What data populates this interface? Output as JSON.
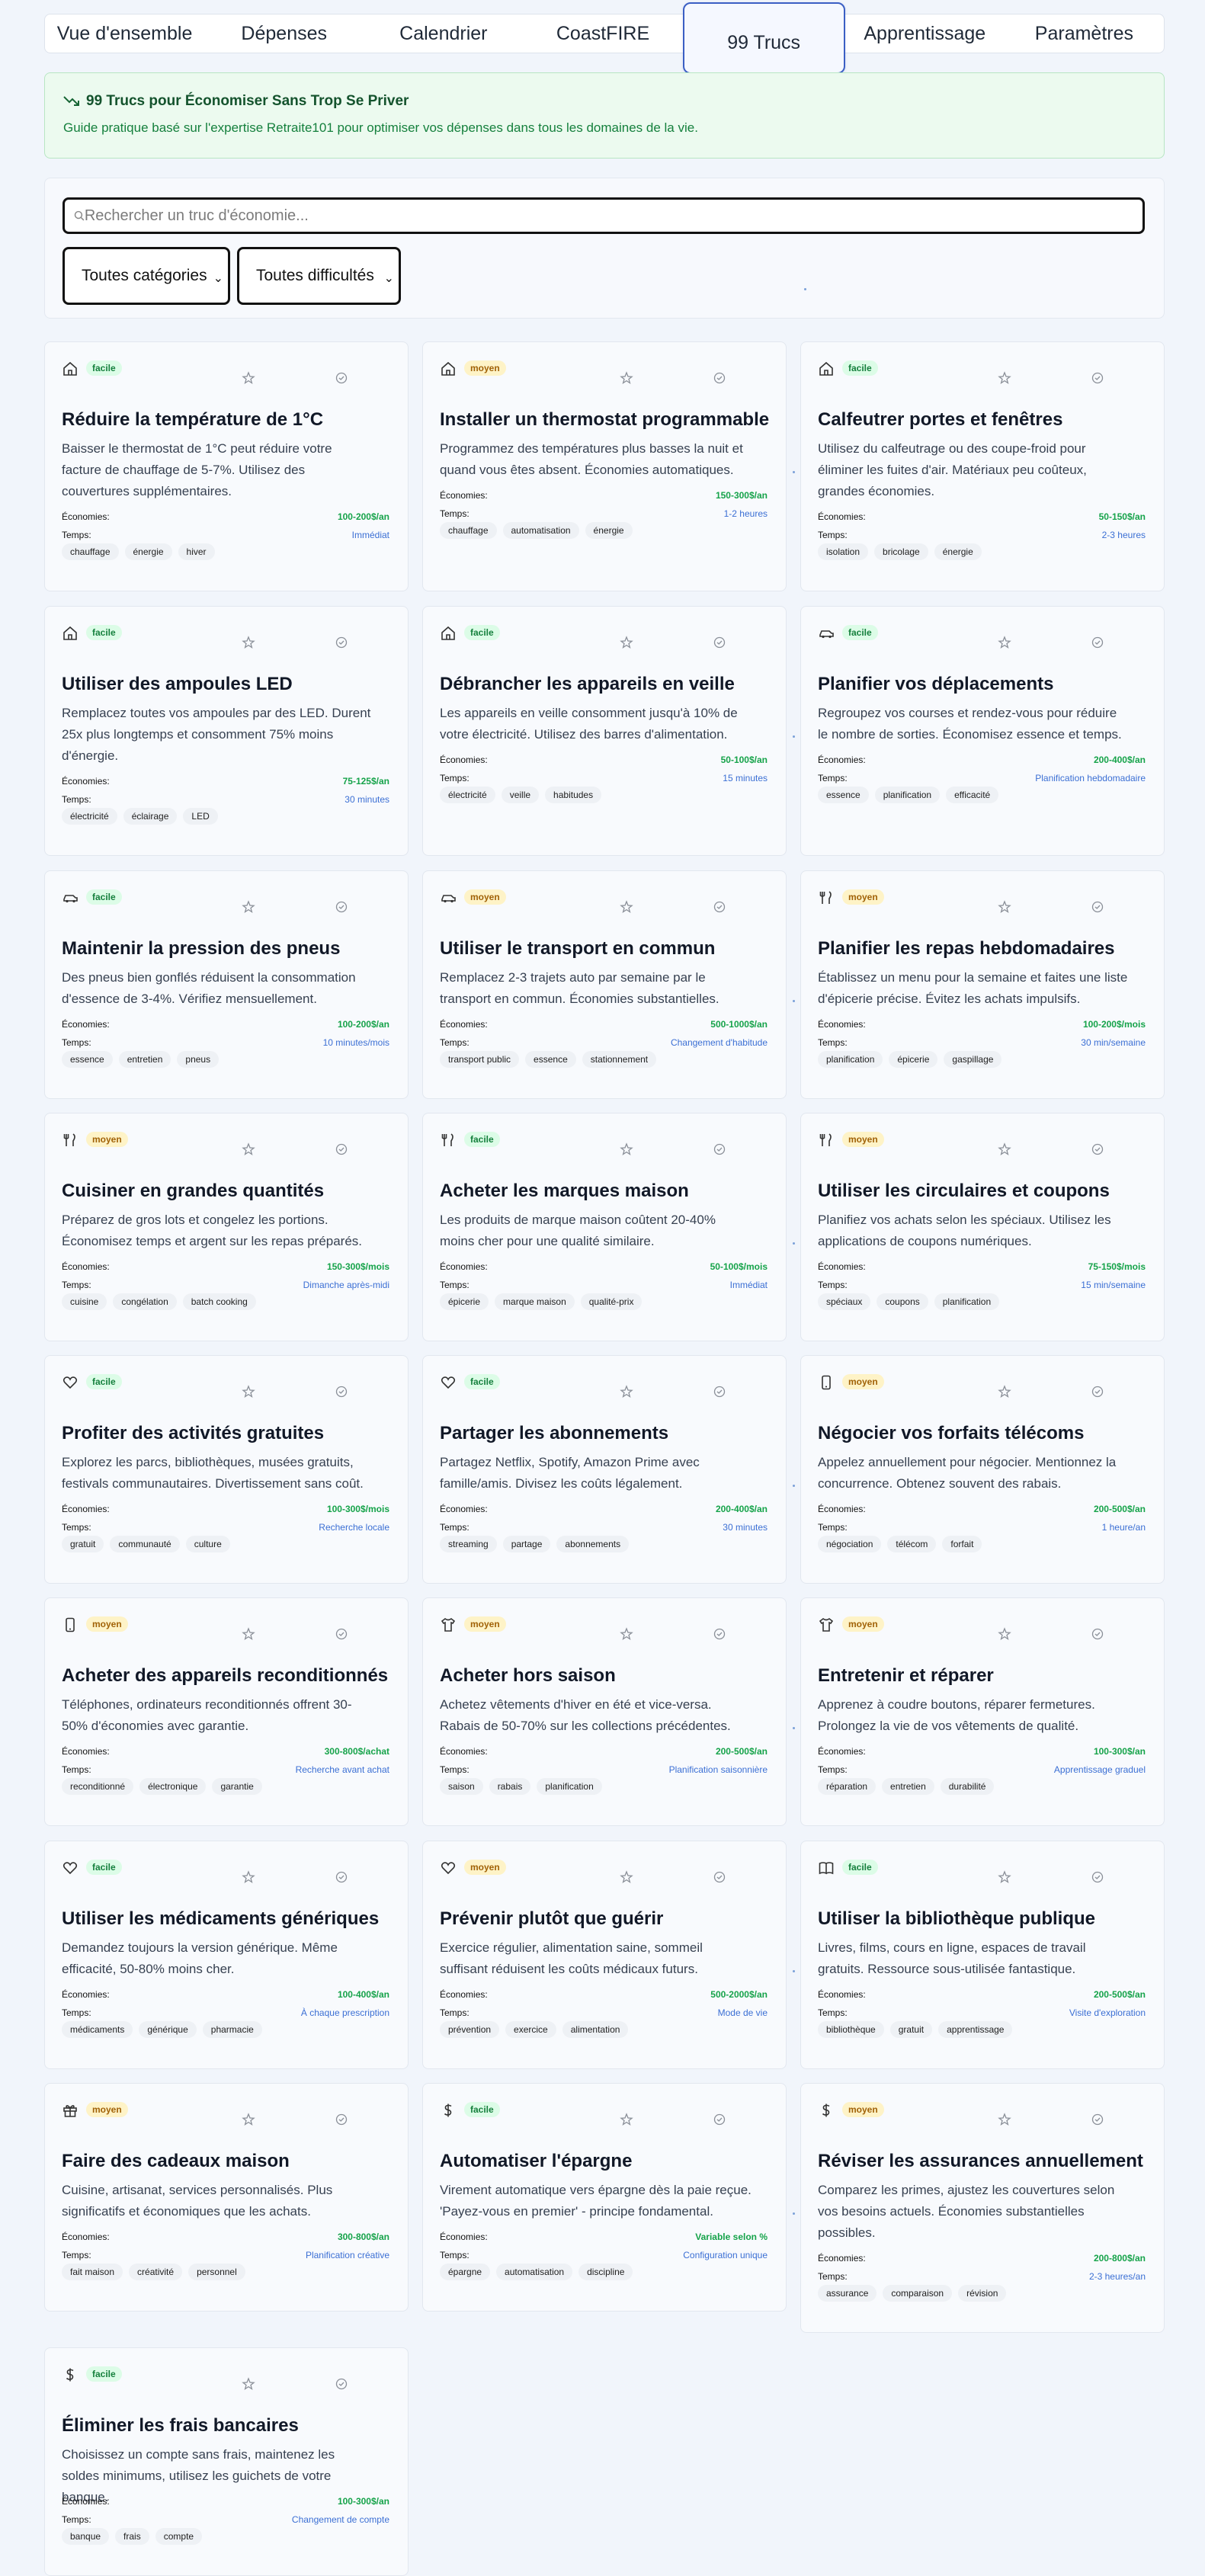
{
  "tabs": [
    {
      "label": "Vue d'ensemble"
    },
    {
      "label": "Dépenses"
    },
    {
      "label": "Calendrier"
    },
    {
      "label": "CoastFIRE"
    },
    {
      "label": "99 Trucs",
      "active": true
    },
    {
      "label": "Apprentissage"
    },
    {
      "label": "Paramètres"
    }
  ],
  "banner": {
    "title": "99 Trucs pour Économiser Sans Trop Se Priver",
    "subtitle": "Guide pratique basé sur l'expertise Retraite101 pour optimiser vos dépenses dans tous les domaines de la vie."
  },
  "filters": {
    "search_placeholder": "Rechercher un truc d'économie...",
    "category": "Toutes catégories",
    "difficulty": "Toutes difficultés"
  },
  "labels": {
    "savings": "Économies:",
    "time": "Temps:"
  },
  "colors": {
    "easy": "#dcfce7",
    "medium": "#fef3c7",
    "savings": "#16a34a",
    "time": "#3b6fd4"
  },
  "tips": [
    {
      "icon": "home-icon",
      "difficulty": "facile",
      "title": "Réduire la température de 1°C",
      "desc": "Baisser le thermostat de 1°C peut réduire votre facture de chauffage de 5-7%. Utilisez des couvertures supplémentaires.",
      "savings": "100-200$/an",
      "time": "Immédiat",
      "tags": [
        "chauffage",
        "énergie",
        "hiver"
      ]
    },
    {
      "icon": "home-icon",
      "difficulty": "moyen",
      "title": "Installer un thermostat programmable",
      "desc": "Programmez des températures plus basses la nuit et quand vous êtes absent. Économies automatiques.",
      "savings": "150-300$/an",
      "time": "1-2 heures",
      "tags": [
        "chauffage",
        "automatisation",
        "énergie"
      ]
    },
    {
      "icon": "home-icon",
      "difficulty": "facile",
      "title": "Calfeutrer portes et fenêtres",
      "desc": "Utilisez du calfeutrage ou des coupe-froid pour éliminer les fuites d'air. Matériaux peu coûteux, grandes économies.",
      "savings": "50-150$/an",
      "time": "2-3 heures",
      "tags": [
        "isolation",
        "bricolage",
        "énergie"
      ]
    },
    {
      "icon": "home-icon",
      "difficulty": "facile",
      "title": "Utiliser des ampoules LED",
      "desc": "Remplacez toutes vos ampoules par des LED. Durent 25x plus longtemps et consomment 75% moins d'énergie.",
      "savings": "75-125$/an",
      "time": "30 minutes",
      "tags": [
        "électricité",
        "éclairage",
        "LED"
      ]
    },
    {
      "icon": "home-icon",
      "difficulty": "facile",
      "title": "Débrancher les appareils en veille",
      "desc": "Les appareils en veille consomment jusqu'à 10% de votre électricité. Utilisez des barres d'alimentation.",
      "savings": "50-100$/an",
      "time": "15 minutes",
      "tags": [
        "électricité",
        "veille",
        "habitudes"
      ]
    },
    {
      "icon": "car-icon",
      "difficulty": "facile",
      "title": "Planifier vos déplacements",
      "desc": "Regroupez vos courses et rendez-vous pour réduire le nombre de sorties. Économisez essence et temps.",
      "savings": "200-400$/an",
      "time": "Planification hebdomadaire",
      "tags": [
        "essence",
        "planification",
        "efficacité"
      ]
    },
    {
      "icon": "car-icon",
      "difficulty": "facile",
      "title": "Maintenir la pression des pneus",
      "desc": "Des pneus bien gonflés réduisent la consommation d'essence de 3-4%. Vérifiez mensuellement.",
      "savings": "100-200$/an",
      "time": "10 minutes/mois",
      "tags": [
        "essence",
        "entretien",
        "pneus"
      ]
    },
    {
      "icon": "car-icon",
      "difficulty": "moyen",
      "title": "Utiliser le transport en commun",
      "desc": "Remplacez 2-3 trajets auto par semaine par le transport en commun. Économies substantielles.",
      "savings": "500-1000$/an",
      "time": "Changement d'habitude",
      "tags": [
        "transport public",
        "essence",
        "stationnement"
      ]
    },
    {
      "icon": "utensils-icon",
      "difficulty": "moyen",
      "title": "Planifier les repas hebdomadaires",
      "desc": "Établissez un menu pour la semaine et faites une liste d'épicerie précise. Évitez les achats impulsifs.",
      "savings": "100-200$/mois",
      "time": "30 min/semaine",
      "tags": [
        "planification",
        "épicerie",
        "gaspillage"
      ]
    },
    {
      "icon": "utensils-icon",
      "difficulty": "moyen",
      "title": "Cuisiner en grandes quantités",
      "desc": "Préparez de gros lots et congelez les portions. Économisez temps et argent sur les repas préparés.",
      "savings": "150-300$/mois",
      "time": "Dimanche après-midi",
      "tags": [
        "cuisine",
        "congélation",
        "batch cooking"
      ]
    },
    {
      "icon": "utensils-icon",
      "difficulty": "facile",
      "title": "Acheter les marques maison",
      "desc": "Les produits de marque maison coûtent 20-40% moins cher pour une qualité similaire.",
      "savings": "50-100$/mois",
      "time": "Immédiat",
      "tags": [
        "épicerie",
        "marque maison",
        "qualité-prix"
      ]
    },
    {
      "icon": "utensils-icon",
      "difficulty": "moyen",
      "title": "Utiliser les circulaires et coupons",
      "desc": "Planifiez vos achats selon les spéciaux. Utilisez les applications de coupons numériques.",
      "savings": "75-150$/mois",
      "time": "15 min/semaine",
      "tags": [
        "spéciaux",
        "coupons",
        "planification"
      ]
    },
    {
      "icon": "heart-icon",
      "difficulty": "facile",
      "title": "Profiter des activités gratuites",
      "desc": "Explorez les parcs, bibliothèques, musées gratuits, festivals communautaires. Divertissement sans coût.",
      "savings": "100-300$/mois",
      "time": "Recherche locale",
      "tags": [
        "gratuit",
        "communauté",
        "culture"
      ]
    },
    {
      "icon": "heart-icon",
      "difficulty": "facile",
      "title": "Partager les abonnements",
      "desc": "Partagez Netflix, Spotify, Amazon Prime avec famille/amis. Divisez les coûts légalement.",
      "savings": "200-400$/an",
      "time": "30 minutes",
      "tags": [
        "streaming",
        "partage",
        "abonnements"
      ]
    },
    {
      "icon": "phone-icon",
      "difficulty": "moyen",
      "title": "Négocier vos forfaits télécoms",
      "desc": "Appelez annuellement pour négocier. Mentionnez la concurrence. Obtenez souvent des rabais.",
      "savings": "200-500$/an",
      "time": "1 heure/an",
      "tags": [
        "négociation",
        "télécom",
        "forfait"
      ]
    },
    {
      "icon": "phone-icon",
      "difficulty": "moyen",
      "title": "Acheter des appareils reconditionnés",
      "desc": "Téléphones, ordinateurs reconditionnés offrent 30-50% d'économies avec garantie.",
      "savings": "300-800$/achat",
      "time": "Recherche avant achat",
      "tags": [
        "reconditionné",
        "électronique",
        "garantie"
      ]
    },
    {
      "icon": "shirt-icon",
      "difficulty": "moyen",
      "title": "Acheter hors saison",
      "desc": "Achetez vêtements d'hiver en été et vice-versa. Rabais de 50-70% sur les collections précédentes.",
      "savings": "200-500$/an",
      "time": "Planification saisonnière",
      "tags": [
        "saison",
        "rabais",
        "planification"
      ]
    },
    {
      "icon": "shirt-icon",
      "difficulty": "moyen",
      "title": "Entretenir et réparer",
      "desc": "Apprenez à coudre boutons, réparer fermetures. Prolongez la vie de vos vêtements de qualité.",
      "savings": "100-300$/an",
      "time": "Apprentissage graduel",
      "tags": [
        "réparation",
        "entretien",
        "durabilité"
      ]
    },
    {
      "icon": "heart-icon",
      "difficulty": "facile",
      "title": "Utiliser les médicaments génériques",
      "desc": "Demandez toujours la version générique. Même efficacité, 50-80% moins cher.",
      "savings": "100-400$/an",
      "time": "À chaque prescription",
      "tags": [
        "médicaments",
        "générique",
        "pharmacie"
      ]
    },
    {
      "icon": "heart-icon",
      "difficulty": "moyen",
      "title": "Prévenir plutôt que guérir",
      "desc": "Exercice régulier, alimentation saine, sommeil suffisant réduisent les coûts médicaux futurs.",
      "savings": "500-2000$/an",
      "time": "Mode de vie",
      "tags": [
        "prévention",
        "exercice",
        "alimentation"
      ]
    },
    {
      "icon": "book-icon",
      "difficulty": "facile",
      "title": "Utiliser la bibliothèque publique",
      "desc": "Livres, films, cours en ligne, espaces de travail gratuits. Ressource sous-utilisée fantastique.",
      "savings": "200-500$/an",
      "time": "Visite d'exploration",
      "tags": [
        "bibliothèque",
        "gratuit",
        "apprentissage"
      ]
    },
    {
      "icon": "gift-icon",
      "difficulty": "moyen",
      "title": "Faire des cadeaux maison",
      "desc": "Cuisine, artisanat, services personnalisés. Plus significatifs et économiques que les achats.",
      "savings": "300-800$/an",
      "time": "Planification créative",
      "tags": [
        "fait maison",
        "créativité",
        "personnel"
      ]
    },
    {
      "icon": "dollar-icon",
      "difficulty": "facile",
      "title": "Automatiser l'épargne",
      "desc": "Virement automatique vers épargne dès la paie reçue. 'Payez-vous en premier' - principe fondamental.",
      "savings": "Variable selon %",
      "time": "Configuration unique",
      "tags": [
        "épargne",
        "automatisation",
        "discipline"
      ]
    },
    {
      "icon": "dollar-icon",
      "difficulty": "moyen",
      "title": "Réviser les assurances annuellement",
      "desc": "Comparez les primes, ajustez les couvertures selon vos besoins actuels. Économies substantielles possibles.",
      "savings": "200-800$/an",
      "time": "2-3 heures/an",
      "tags": [
        "assurance",
        "comparaison",
        "révision"
      ]
    },
    {
      "icon": "dollar-icon",
      "difficulty": "facile",
      "title": "Éliminer les frais bancaires",
      "desc": "Choisissez un compte sans frais, maintenez les soldes minimums, utilisez les guichets de votre banque.",
      "savings": "100-300$/an",
      "time": "Changement de compte",
      "tags": [
        "banque",
        "frais",
        "compte"
      ]
    }
  ]
}
